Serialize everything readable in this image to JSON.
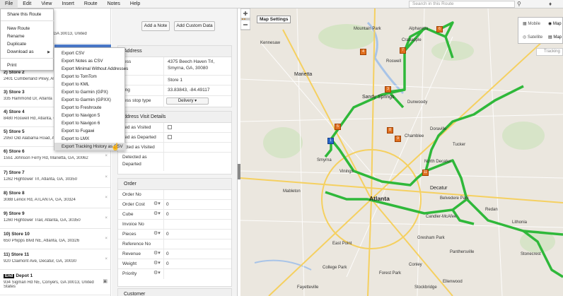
{
  "menubar": {
    "items": [
      "File",
      "Edit",
      "View",
      "Insert",
      "Route",
      "Notes",
      "Help"
    ],
    "search_placeholder": "Search in this Route"
  },
  "file_menu": {
    "share": "Share this Route",
    "new_route": "New Route",
    "rename": "Rename",
    "duplicate": "Duplicate",
    "download_as": "Download as",
    "print": "Print"
  },
  "export_menu": {
    "items": [
      "Export CSV",
      "Export Notes as CSV",
      "Export Minimal Without Addresses",
      "Export to TomTom",
      "Export to KML",
      "Export to Garmin (GPX)",
      "Export to Garmin (GPXX)",
      "Export to Freshroute",
      "Export to Navigon 5",
      "Export to Navigon 6",
      "Export to Fugawi",
      "Export to LMX",
      "Export Tracking History as CSV"
    ]
  },
  "stops": {
    "partial_top": "rs, GA 30013, United",
    "s2_name": "2) Store 2",
    "s2_addr": "2401 Cumberland Pkwy, Atlanta",
    "s3_name": "3) Store 3",
    "s3_addr": "335 Hammond Dr, Atlanta",
    "s4_name": "4) Store 4",
    "s4_addr": "8480 Roswell Rd, Atlanta, G",
    "s5_name": "5) Store 5",
    "s5_addr": "2950 Old Alabama Road, Al",
    "s6_name": "6) Store 6",
    "s6_addr": "1551 Johnson Ferry Rd, Marietta, GA, 30062",
    "s7_name": "7) Store 7",
    "s7_addr": "1262 Hightower Trl, Atlanta, GA, 30350",
    "s8_name": "8) Store 8",
    "s8_addr": "3088 Lenox Rd, ATLANTA, GA, 30324",
    "s9_name": "9) Store 9",
    "s9_addr": "1260 Hightower Trail, Atlanta, GA, 30350",
    "s10_name": "10) Store 10",
    "s10_addr": "650 Phipps Blvd NE, Atlanta, GA, 30326",
    "s11_name": "11) Store 11",
    "s11_addr": "920 Claimont Ave, Decatur, GA, 30030",
    "end_badge": "End",
    "end_name": "Depot 1",
    "end_addr": "934 Sigman Rd NE, Conyers, GA 30013, United",
    "end_addr2": "States",
    "remove_symbol": "×"
  },
  "middle": {
    "add_note": "Add a Note",
    "add_custom": "Add Custom Data",
    "address_head": "Address",
    "address_label": "ress",
    "address_value_1": "4375 Beech Haven Trl,",
    "address_value_2": "Smyrna, GA, 30080",
    "name_value": "Store 1",
    "latlng_label": "Lng",
    "latlng_value": "33.83843, -84.49117",
    "stop_type_label": "ress stop type",
    "stop_type_value": "Delivery ▾",
    "visit_head": "ddress Visit Details",
    "marked_visited": "ked as Visited",
    "marked_departed": "ked as Departed",
    "detected_visited": "ected as Visited",
    "detected_departed_1": "Detected as",
    "detected_departed_2": "Departed",
    "order_head": "Order",
    "order_rows": [
      "Order No",
      "Order Cost",
      "Cube",
      "Invoice No",
      "Pieces",
      "Reference No",
      "Revenue",
      "Weight",
      "Priority"
    ],
    "zero": "0",
    "customer_head": "Customer"
  },
  "map": {
    "settings": "Map Settings",
    "mode_mobile": "Mobile",
    "mode_map": "Map",
    "mode_satellite": "Satellite",
    "mode_map2": "Map",
    "tracking": "Tracking",
    "labels": {
      "atlanta": "Atlanta",
      "marietta": "Marietta",
      "sandy_springs": "Sandy Springs",
      "decatur": "Decatur",
      "smyrna": "Smyrna",
      "dunwoody": "Dunwoody",
      "alpharetta": "Alpharetta",
      "roswell": "Roswell",
      "kennesaw": "Kennesaw",
      "east_point": "East Point",
      "candler_mcafee": "Candler-McAfee",
      "gresham_park": "Gresham Park",
      "belvedere_park": "Belvedere Park",
      "tucker": "Tucker",
      "north_decatur": "North Decatur",
      "panthersville": "Panthersville",
      "redan": "Redan",
      "lithonia": "Lithonia",
      "stonecrest": "Stonecrest",
      "mountain_park": "Mountain Park",
      "crabapple": "Crabapple",
      "chamblee": "Chamblee",
      "doraville": "Doraville",
      "vinings": "Vinings",
      "mableton": "Mableton",
      "forest_park": "Forest Park",
      "college_park": "College Park",
      "conley": "Conley",
      "ellenwood": "Ellenwood",
      "stockbridge": "Stockbridge",
      "fayetteville": "Fayetteville"
    },
    "colors": {
      "route": "#2fb83a",
      "marker": "#e07020",
      "water": "#a8c4e8",
      "road": "#f5d060"
    }
  }
}
